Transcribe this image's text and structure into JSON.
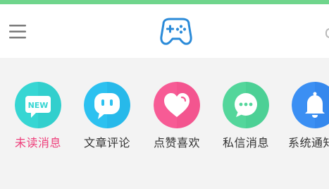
{
  "theme": {
    "top_stripe_color": "#6fd58c",
    "header_bg": "#ffffff",
    "page_bg": "#f3f3f3",
    "brand_color": "#2a8ad8",
    "active_label_color": "#ee3d7a"
  },
  "header": {
    "menu_icon": "hamburger-menu-icon",
    "logo_icon": "gamepad-icon"
  },
  "categories": [
    {
      "label": "未读消息",
      "icon": "new-badge-icon",
      "color": "#36d6d3",
      "active": true
    },
    {
      "label": "文章评论",
      "icon": "chat-bubble-face-icon",
      "color": "#2cc1f0",
      "active": false
    },
    {
      "label": "点赞喜欢",
      "icon": "heart-icon",
      "color": "#f75b95",
      "active": false
    },
    {
      "label": "私信消息",
      "icon": "message-dots-icon",
      "color": "#53d69b",
      "active": false
    },
    {
      "label": "系统通知",
      "icon": "bell-icon",
      "color": "#3b8ff3",
      "active": false
    }
  ]
}
